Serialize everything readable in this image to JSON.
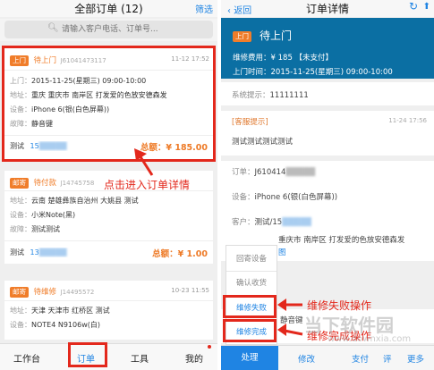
{
  "left": {
    "header": {
      "title": "全部订单 (12)",
      "filter": "筛选"
    },
    "search": {
      "placeholder": "请输入客户电话、订单号..."
    },
    "orders": [
      {
        "type": "上门",
        "status": "待上门",
        "order_id": "J61041473117",
        "time": "11-12 17:52",
        "rows": [
          {
            "label": "上门：",
            "value": "2015-11-25(星期三) 09:00-10:00"
          },
          {
            "label": "地址：",
            "value": "重庆 重庆市 南岸区 打发爱的色放安德森发"
          },
          {
            "label": "设备：",
            "value": "iPhone 6(银(白色屏幕))"
          },
          {
            "label": "故障：",
            "value": "静音键"
          }
        ],
        "customer": "测试",
        "phone": "15",
        "total": "总额：¥ 185.00"
      },
      {
        "type": "邮寄",
        "status": "待付款",
        "order_id": "J14745758",
        "time": "",
        "rows": [
          {
            "label": "地址：",
            "value": "云南 楚雄彝族自治州 大姚县 测试"
          },
          {
            "label": "设备：",
            "value": "小米Note(黑)"
          },
          {
            "label": "故障：",
            "value": "测试测试"
          }
        ],
        "customer": "测试",
        "phone": "13",
        "total": "总额：¥ 1.00"
      },
      {
        "type": "邮寄",
        "status": "待维修",
        "order_id": "J14495572",
        "time": "10-23 11:55",
        "rows": [
          {
            "label": "地址：",
            "value": "天津 天津市 红桥区 测试"
          },
          {
            "label": "设备：",
            "value": "NOTE4 N9106w(白)"
          }
        ]
      }
    ],
    "annotation": "点击进入订单详情",
    "tabs": [
      "工作台",
      "订单",
      "工具",
      "我的"
    ]
  },
  "right": {
    "header": {
      "back": "返回",
      "title": "订单详情"
    },
    "status": {
      "type": "上门",
      "text": "待上门",
      "fee_label": "维修费用：",
      "fee_value": "¥ 185  【未支付】",
      "time_label": "上门时间：",
      "time_value": "2015-11-25(星期三) 09:00-10:00"
    },
    "system_notice": {
      "label": "系统提示：",
      "value": "11111111"
    },
    "service_notice": {
      "title": "[客服提示]",
      "time": "11-24 17:56",
      "content": "测试测试测试测试"
    },
    "order": {
      "label": "订单：",
      "value": "J610414"
    },
    "device": {
      "label": "设备：",
      "value": "iPhone 6(银(白色屏幕))"
    },
    "customer": {
      "label": "客户：",
      "value": "测试/15"
    },
    "address": {
      "value": "重庆市 南岸区 打发爱的色放安德森发",
      "link": "图"
    },
    "fault": {
      "value": "静音键"
    },
    "popup": [
      "回寄设备",
      "确认收货",
      "维修失败",
      "维修完成"
    ],
    "annotations": [
      "维修失败操作",
      "维修完成操作"
    ],
    "tabs": [
      "处理",
      "修改",
      "支付",
      "评",
      "更多"
    ]
  },
  "watermark": {
    "text": "当下软件园",
    "url": "www.downxia.com"
  }
}
